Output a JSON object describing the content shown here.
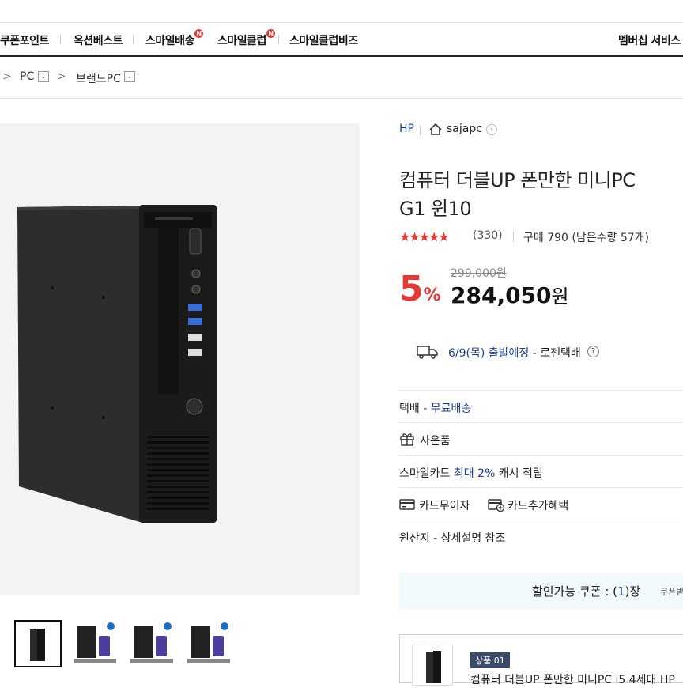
{
  "topnav": {
    "items": [
      "쿠폰포인트",
      "옥션베스트",
      "스마일배송",
      "스마일클럽",
      "스마일클럽비즈"
    ],
    "new_badge": "N",
    "right": "멤버십 서비스"
  },
  "breadcrumb": {
    "sep": ">",
    "level1": "PC",
    "level2": "브랜드PC",
    "dropdown_glyph": "⌄"
  },
  "product": {
    "brand": "HP",
    "shop": "sajapc",
    "title_line1": "컴퓨터 더블UP 폰만한 미니PC",
    "title_line2": "G1 윈10",
    "stars": "★★★★★",
    "review_count": "(330)",
    "purchase": "구매 790 (남은수량 57개)",
    "original_price": "299,000원",
    "discount_num": "5",
    "discount_pct": "%",
    "price": "284,050",
    "price_unit": "원",
    "rating": 5
  },
  "shipping": {
    "date": "6/9(목) 출발예정",
    "carrier": " - 로젠택배",
    "help": "?"
  },
  "rows": {
    "delivery_label": "택배",
    "delivery_value": " - 무료배송",
    "gift": "사은품",
    "smilecard_prefix": "스마일카드 ",
    "smilecard_highlight": "최대 2%",
    "smilecard_suffix": " 캐시 적립",
    "card_interest": "카드무이자",
    "card_benefit": "카드추가혜택",
    "origin": "원산지 - 상세설명 참조"
  },
  "coupon": {
    "text_prefix": "할인가능 쿠폰 : (",
    "count": "1",
    "text_suffix": ")장",
    "more": "쿠폰받"
  },
  "option": {
    "badge": "상품 01",
    "name": "컴퓨터 더블UP 폰만한 미니PC i5 4세대 HP"
  },
  "colors": {
    "accent_red": "#e53935",
    "accent_blue": "#1a3e8c"
  }
}
